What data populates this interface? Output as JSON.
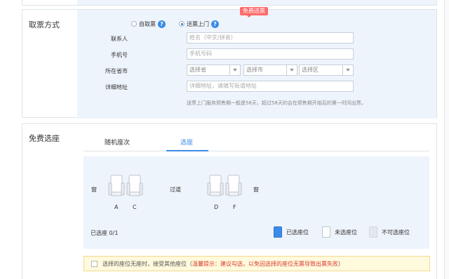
{
  "ticket": {
    "section_title": "取票方式",
    "radio_self": "自取票",
    "radio_delivery": "送票上门",
    "help_glyph": "?",
    "badge": "免费送票",
    "contact_label": "联系人",
    "contact_placeholder": "姓名（中文/拼音）",
    "phone_label": "手机号",
    "phone_placeholder": "手机号码",
    "region_label": "所在省市",
    "province_placeholder": "选择省",
    "city_placeholder": "选择市",
    "district_placeholder": "选择区",
    "address_label": "详细地址",
    "address_placeholder": "详细地址，请填写街道地址",
    "note": "送票上门服务预售期一般是58天，超过58天的会在预售期开始后的第一时间出票。"
  },
  "seat": {
    "section_title": "免费选座",
    "tab_random": "随机座次",
    "tab_choose": "选座",
    "window": "窗",
    "aisle": "过道",
    "letter_a": "A",
    "letter_c": "C",
    "letter_d": "D",
    "letter_f": "F",
    "selected_count": "已选座 0/1",
    "legend_sold": "已选座位",
    "legend_free": "未选座位",
    "legend_na": "不可选座位",
    "warn_text": "选择的座位无座时，接受其他座位（",
    "warn_red": "温馨提示：建议勾选，以免因选择的座位无票导致出票失败",
    "warn_end": "）"
  },
  "colors": {
    "accent": "#3b8be8",
    "badge": "#ff6b6b",
    "panel_bg": "#eef4fb",
    "warn_red": "#d9392b"
  }
}
